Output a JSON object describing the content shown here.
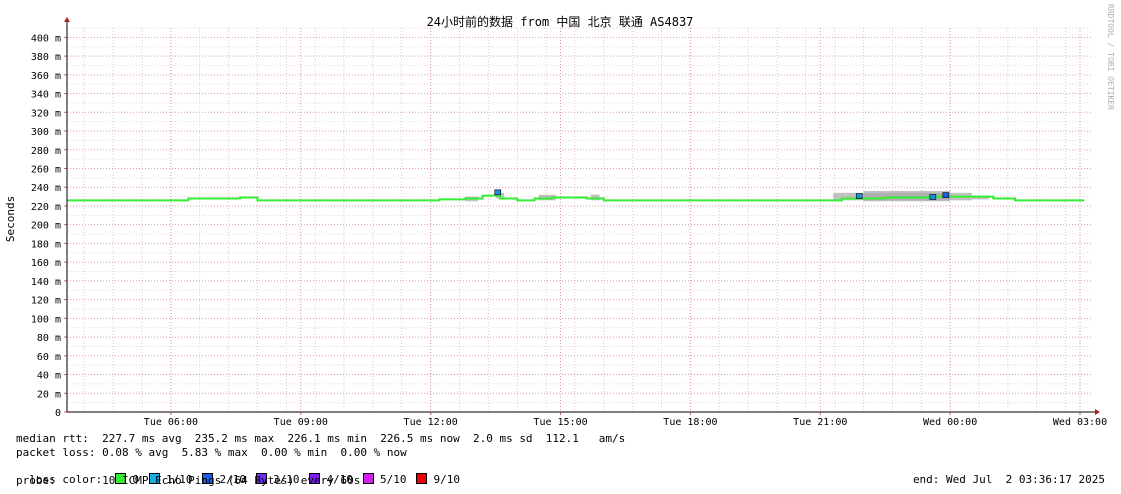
{
  "chart_data": {
    "type": "line",
    "title": "24小时前的数据 from 中国 北京 联通 AS4837",
    "ylabel": "Seconds",
    "watermark": "RRDTOOL / TOBI OETIKER",
    "ylim": [
      0,
      410
    ],
    "yticks": [
      {
        "v": 0,
        "label": "0"
      },
      {
        "v": 20,
        "label": "20 m"
      },
      {
        "v": 40,
        "label": "40 m"
      },
      {
        "v": 60,
        "label": "60 m"
      },
      {
        "v": 80,
        "label": "80 m"
      },
      {
        "v": 100,
        "label": "100 m"
      },
      {
        "v": 120,
        "label": "120 m"
      },
      {
        "v": 140,
        "label": "140 m"
      },
      {
        "v": 160,
        "label": "160 m"
      },
      {
        "v": 180,
        "label": "180 m"
      },
      {
        "v": 200,
        "label": "200 m"
      },
      {
        "v": 220,
        "label": "220 m"
      },
      {
        "v": 240,
        "label": "240 m"
      },
      {
        "v": 260,
        "label": "260 m"
      },
      {
        "v": 280,
        "label": "280 m"
      },
      {
        "v": 300,
        "label": "300 m"
      },
      {
        "v": 320,
        "label": "320 m"
      },
      {
        "v": 340,
        "label": "340 m"
      },
      {
        "v": 360,
        "label": "360 m"
      },
      {
        "v": 380,
        "label": "380 m"
      },
      {
        "v": 400,
        "label": "400 m"
      }
    ],
    "xlim": [
      3.6,
      27.3
    ],
    "xticks": [
      {
        "h": 6,
        "label": "Tue 06:00"
      },
      {
        "h": 9,
        "label": "Tue 09:00"
      },
      {
        "h": 12,
        "label": "Tue 12:00"
      },
      {
        "h": 15,
        "label": "Tue 15:00"
      },
      {
        "h": 18,
        "label": "Tue 18:00"
      },
      {
        "h": 21,
        "label": "Tue 21:00"
      },
      {
        "h": 24,
        "label": "Wed 00:00"
      },
      {
        "h": 27,
        "label": "Wed 03:00"
      }
    ],
    "grid": true,
    "series": [
      {
        "name": "0",
        "color": "#33ee33",
        "x": [
          3.6,
          6.2,
          6.4,
          7.6,
          8.0,
          11.8,
          12.2,
          12.8,
          13.2,
          13.6,
          14.0,
          14.4,
          14.8,
          15.6,
          16.0,
          21.0,
          21.5,
          22.5,
          23.5,
          24.5,
          25.0,
          25.5,
          27.1
        ],
        "y": [
          226,
          226,
          228,
          229,
          226,
          226,
          227,
          228,
          231,
          228,
          226,
          228,
          229,
          228,
          226,
          226,
          228,
          229,
          230,
          230,
          228,
          226,
          226
        ]
      }
    ],
    "smoke_bands": [
      {
        "x0": 12.8,
        "x1": 13.1,
        "low": 225,
        "high": 230
      },
      {
        "x0": 13.5,
        "x1": 13.7,
        "low": 228,
        "high": 234
      },
      {
        "x0": 14.5,
        "x1": 14.9,
        "low": 226,
        "high": 232
      },
      {
        "x0": 15.7,
        "x1": 15.9,
        "low": 226,
        "high": 232
      },
      {
        "x0": 21.3,
        "x1": 24.5,
        "low": 226,
        "high": 234
      },
      {
        "x0": 22.0,
        "x1": 24.0,
        "low": 225,
        "high": 236
      },
      {
        "x0": 24.5,
        "x1": 24.9,
        "low": 227,
        "high": 231
      }
    ],
    "loss_marks": [
      {
        "x": 13.55,
        "y": 234,
        "color": "#1a8fd6"
      },
      {
        "x": 21.9,
        "y": 230,
        "color": "#1a8fd6"
      },
      {
        "x": 23.6,
        "y": 229,
        "color": "#1a8fd6"
      },
      {
        "x": 23.9,
        "y": 231,
        "color": "#1a5fe6"
      }
    ]
  },
  "stats": {
    "median_rtt": "median rtt:  227.7 ms avg  235.2 ms max  226.1 ms min  226.5 ms now  2.0 ms sd  112.1   am/s",
    "packet_loss": "packet loss: 0.08 % avg  5.83 % max  0.00 % min  0.00 % now",
    "loss_color_label": "loss color:",
    "loss_colors": [
      {
        "label": "0",
        "color": "#33ee33"
      },
      {
        "label": "1/10",
        "color": "#18b0e8"
      },
      {
        "label": "2/10",
        "color": "#1a5fe6"
      },
      {
        "label": "3/10",
        "color": "#6a2ff0"
      },
      {
        "label": "4/10",
        "color": "#7a1ff0"
      },
      {
        "label": "5/10",
        "color": "#d21ff0"
      },
      {
        "label": "9/10",
        "color": "#f00000"
      }
    ],
    "probe": "probe:       10 ICMP Echo Pings (64 Bytes) every 60s",
    "end": "end: Wed Jul  2 03:36:17 2025"
  }
}
